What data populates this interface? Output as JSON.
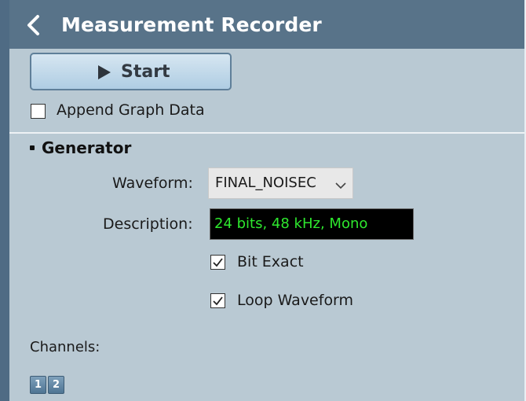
{
  "header": {
    "back_icon": "chevron-left-icon",
    "title": "Measurement Recorder"
  },
  "controls": {
    "start_label": "Start",
    "start_icon": "play-icon",
    "append_graph_data": {
      "label": "Append Graph Data",
      "checked": false
    }
  },
  "generator": {
    "section_title": "Generator",
    "waveform": {
      "label": "Waveform:",
      "value": "FINAL_NOISEC",
      "dropdown_icon": "chevron-down-icon"
    },
    "description": {
      "label": "Description:",
      "value": "24 bits, 48 kHz, Mono",
      "text_color": "#2ee72e",
      "background": "#000000"
    },
    "bit_exact": {
      "label": "Bit Exact",
      "checked": true
    },
    "loop_waveform": {
      "label": "Loop Waveform",
      "checked": true
    }
  },
  "channels": {
    "label": "Channels:",
    "buttons": [
      "1",
      "2"
    ]
  },
  "colors": {
    "titlebar": "#587389",
    "panel": "#b9c9d3",
    "button_gradient_top": "#d6e6f1",
    "button_gradient_bottom": "#afcde3"
  }
}
